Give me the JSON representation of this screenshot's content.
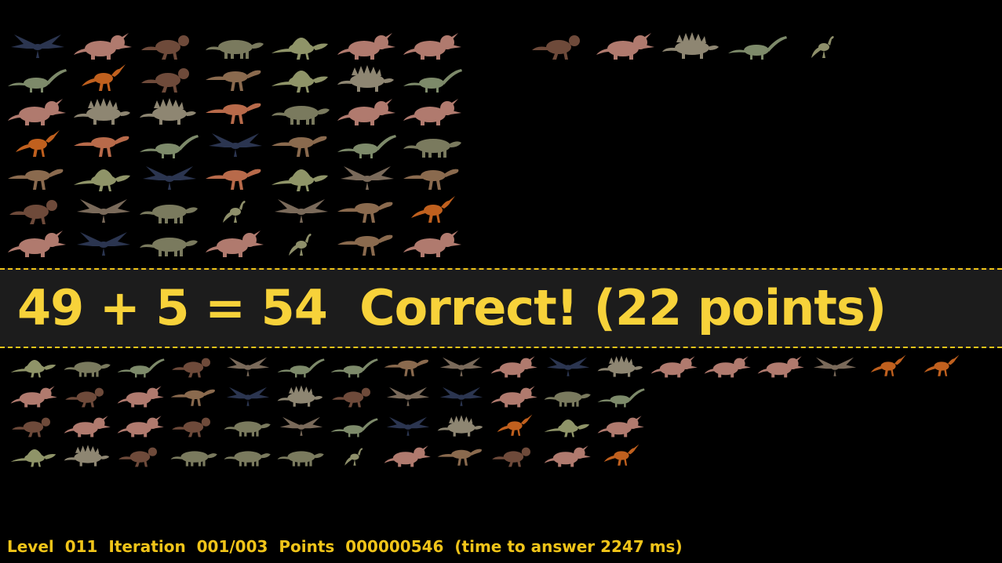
{
  "equation": {
    "left_count": 49,
    "right_count": 5,
    "result": 54,
    "text": "49 + 5 = 54  Correct! (22 points)"
  },
  "status_bar": {
    "text": "Level  011  Iteration  001/003  Points  000000546  (time to answer 2247 ms)"
  },
  "colors": {
    "banner_background": "#1c1c1c",
    "banner_text": "#f7d23a",
    "banner_border": "#f0c419",
    "status_text": "#f0c419",
    "page_background": "#000000"
  },
  "groups": {
    "top_left": {
      "columns": 7,
      "rows": 7,
      "items": [
        "archaeopteryx",
        "triceratops",
        "pachycephalosaurus",
        "ankylosaurus",
        "spinosaurus",
        "triceratops",
        "triceratops",
        "diplodocus",
        "parasaurolophus",
        "pachycephalosaurus",
        "tyrannosaurus",
        "spinosaurus",
        "stegosaurus",
        "diplodocus",
        "triceratops",
        "stegosaurus",
        "stegosaurus",
        "gallimimus",
        "ankylosaurus",
        "triceratops",
        "triceratops",
        "parasaurolophus",
        "gallimimus",
        "diplodocus",
        "archaeopteryx",
        "tyrannosaurus",
        "diplodocus",
        "ankylosaurus",
        "tyrannosaurus",
        "spinosaurus",
        "archaeopteryx",
        "gallimimus",
        "spinosaurus",
        "pterosaur",
        "tyrannosaurus",
        "pachycephalosaurus",
        "pterosaur",
        "ankylosaurus",
        "compsognathus",
        "pterosaur",
        "tyrannosaurus",
        "parasaurolophus",
        "triceratops",
        "archaeopteryx",
        "ankylosaurus",
        "triceratops",
        "compsognathus",
        "tyrannosaurus",
        "triceratops"
      ]
    },
    "top_right": {
      "columns": 5,
      "rows": 1,
      "items": [
        "pachycephalosaurus",
        "triceratops",
        "stegosaurus",
        "diplodocus",
        "compsognathus"
      ]
    },
    "bottom": {
      "rows": [
        [
          "spinosaurus",
          "ankylosaurus",
          "diplodocus",
          "pachycephalosaurus",
          "pterosaur",
          "diplodocus",
          "diplodocus",
          "tyrannosaurus",
          "pterosaur",
          "triceratops",
          "archaeopteryx",
          "stegosaurus",
          "triceratops",
          "triceratops",
          "triceratops",
          "pterosaur",
          "parasaurolophus",
          "parasaurolophus"
        ],
        [
          "triceratops",
          "pachycephalosaurus",
          "triceratops",
          "tyrannosaurus",
          "archaeopteryx",
          "stegosaurus",
          "pachycephalosaurus",
          "pterosaur",
          "archaeopteryx",
          "triceratops",
          "ankylosaurus",
          "diplodocus"
        ],
        [
          "pachycephalosaurus",
          "triceratops",
          "triceratops",
          "pachycephalosaurus",
          "ankylosaurus",
          "pterosaur",
          "diplodocus",
          "archaeopteryx",
          "stegosaurus",
          "parasaurolophus",
          "spinosaurus",
          "triceratops"
        ],
        [
          "spinosaurus",
          "stegosaurus",
          "pachycephalosaurus",
          "ankylosaurus",
          "ankylosaurus",
          "ankylosaurus",
          "compsognathus",
          "triceratops",
          "tyrannosaurus",
          "pachycephalosaurus",
          "triceratops",
          "parasaurolophus"
        ]
      ]
    }
  },
  "species_colors": {
    "archaeopteryx": "#2b3550",
    "triceratops": "#b07a6e",
    "pachycephalosaurus": "#6e4a3a",
    "ankylosaurus": "#7a7a5e",
    "spinosaurus": "#8f9468",
    "diplodocus": "#7d8a6a",
    "parasaurolophus": "#c0601e",
    "tyrannosaurus": "#8a6a4e",
    "stegosaurus": "#8e8672",
    "gallimimus": "#b86a4a",
    "pterosaur": "#7a6a5a",
    "compsognathus": "#8e8f6a"
  }
}
